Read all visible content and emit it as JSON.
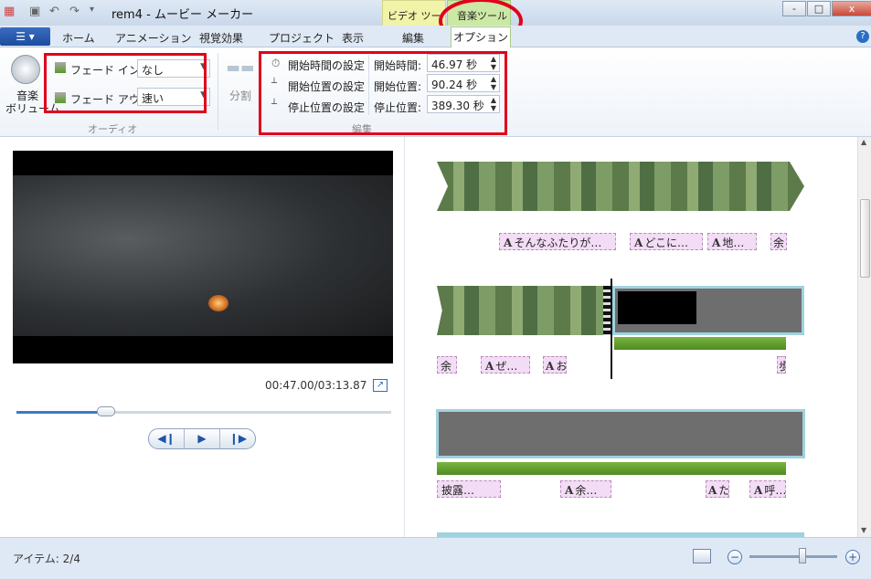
{
  "window": {
    "title": "rem4 - ムービー メーカー",
    "context_tabs": [
      "ビデオ ツール",
      "音楽ツール"
    ],
    "controls": [
      "-",
      "□",
      "x"
    ]
  },
  "ribbon_tabs": [
    "ホーム",
    "アニメーション",
    "視覚効果",
    "プロジェクト",
    "表示",
    "編集",
    "オプション"
  ],
  "file_menu_icon": "menu-icon",
  "audio_group": {
    "volume_label_1": "音楽",
    "volume_label_2": "ボリューム",
    "fade_in_label": "フェード イン:",
    "fade_in_value": "なし",
    "fade_out_label": "フェード アウト:",
    "fade_out_value": "速い",
    "group_label": "オーディオ"
  },
  "split_group": {
    "split_label": "分割"
  },
  "edit_group": {
    "set_start_time": "開始時間の設定",
    "set_start_point": "開始位置の設定",
    "set_end_point": "停止位置の設定",
    "start_time_label": "開始時間:",
    "start_time_value": "46.97 秒",
    "start_point_label": "開始位置:",
    "start_point_value": "90.24 秒",
    "end_point_label": "停止位置:",
    "end_point_value": "389.30 秒",
    "group_label": "編集"
  },
  "player": {
    "timecode": "00:47.00/03:13.87",
    "position_fraction": 0.24
  },
  "storyboard": {
    "captions_row1": [
      "そんなふたりが…",
      "どこに…",
      "地…",
      "余"
    ],
    "captions_row2": [
      "余",
      "ぜ…",
      "お",
      "歩"
    ],
    "captions_row3": [
      "披露…",
      "余…",
      "た",
      "呼…"
    ]
  },
  "status": {
    "items_text": "アイテム: 2/4",
    "zoom_fraction": 0.6
  },
  "colors": {
    "highlight_red": "#e0001c",
    "music_tools_green": "#cce8a5",
    "video_tools_yellow": "#f1f3a8",
    "caption_pink": "#f3dcf5",
    "audio_wave_green": "#5a9a2a"
  }
}
